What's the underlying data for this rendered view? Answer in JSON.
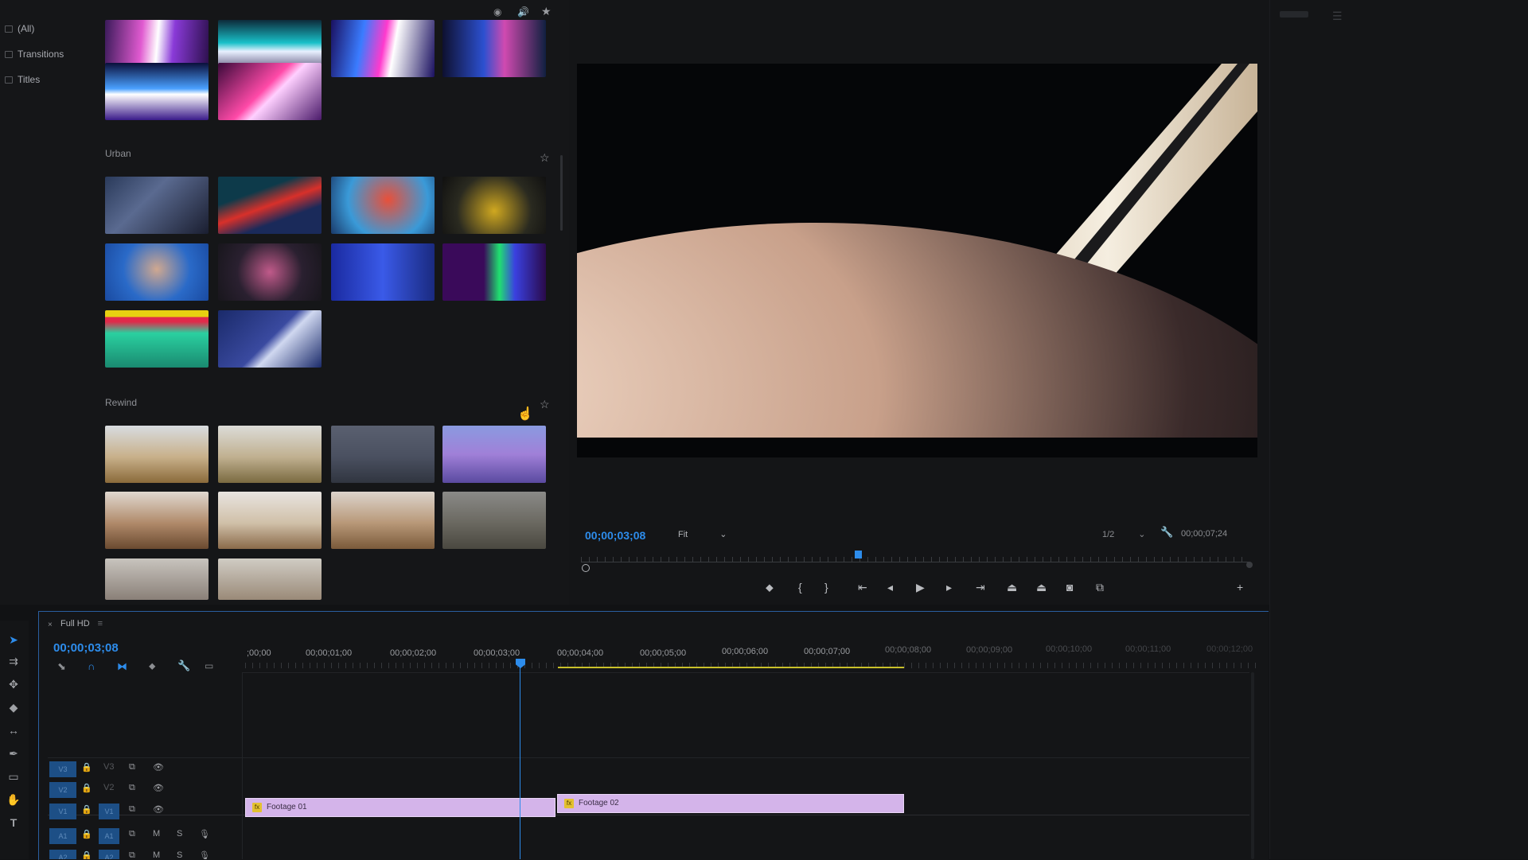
{
  "browser": {
    "categories": [
      "(All)",
      "Transitions",
      "Titles"
    ],
    "sections": [
      {
        "title": ""
      },
      {
        "title": "Urban"
      },
      {
        "title": "Rewind"
      }
    ]
  },
  "monitor": {
    "timecode": "00;00;03;08",
    "zoom": "Fit",
    "quality": "1/2",
    "duration": "00;00;07;24"
  },
  "timeline": {
    "sequence_name": "Full HD",
    "timecode": "00;00;03;08",
    "ruler": [
      ";00;00",
      "00;00;01;00",
      "00;00;02;00",
      "00;00;03;00",
      "00;00;04;00",
      "00;00;05;00",
      "00;00;06;00",
      "00;00;07;00",
      "00;00;08;00",
      "00;00;09;00",
      "00;00;10;00",
      "00;00;11;00",
      "00;00;12;00"
    ],
    "tracks": [
      {
        "id": "V3",
        "label": "V3"
      },
      {
        "id": "V2",
        "label": "V2"
      },
      {
        "id": "V1",
        "label": "V1"
      },
      {
        "id": "A1",
        "label": "A1"
      },
      {
        "id": "A2",
        "label": "A2"
      }
    ],
    "clips": [
      {
        "name": "Footage 01",
        "fx": "fx"
      },
      {
        "name": "Footage 02",
        "fx": "fx"
      }
    ],
    "track_mute": "M",
    "track_solo": "S"
  },
  "colors": {
    "accent": "#2d8ceb",
    "clip": "#d4b4ea",
    "work_area": "#c8c02a"
  },
  "icons": [
    "selection-tool-icon",
    "track-select-icon",
    "ripple-edit-icon",
    "razor-icon",
    "slip-icon",
    "pen-icon",
    "rectangle-icon",
    "hand-icon",
    "type-icon"
  ]
}
